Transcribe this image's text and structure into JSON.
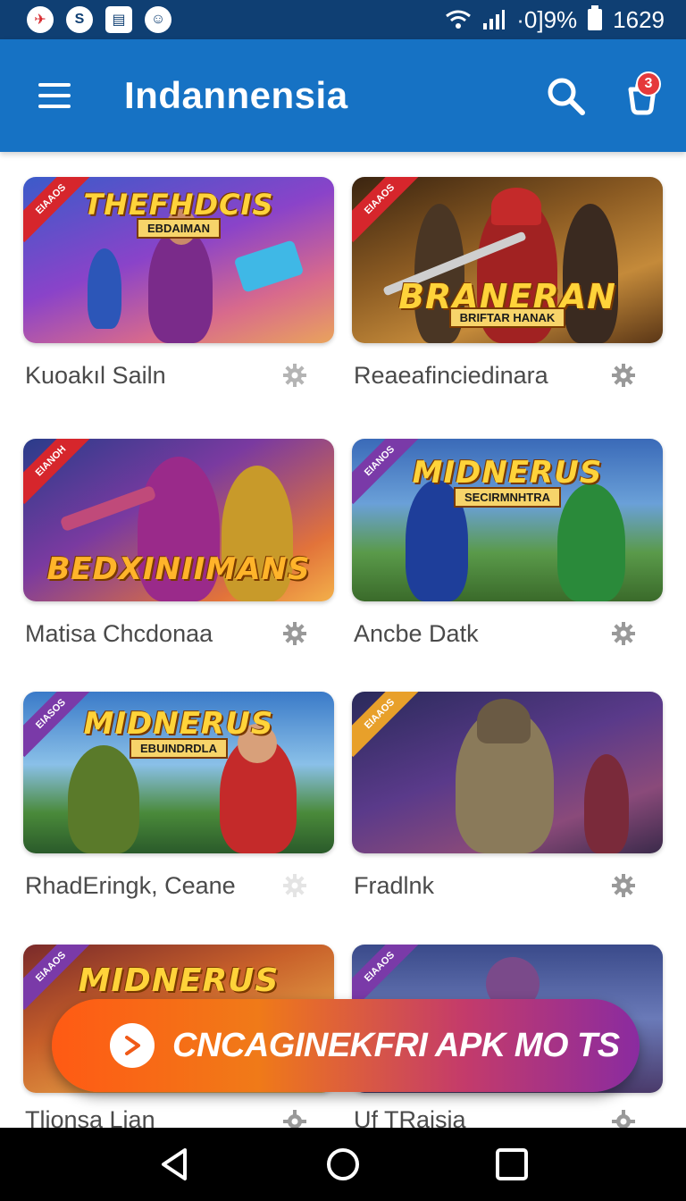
{
  "status_bar": {
    "battery_text": "·0]9%",
    "time": "1629",
    "icons": [
      "app-notification-icon",
      "shazam-icon",
      "message-icon",
      "android-icon",
      "wifi-icon",
      "signal-icon",
      "battery-icon"
    ]
  },
  "app_bar": {
    "title": "Indannensia",
    "cart_badge": "3",
    "colors": {
      "status": "#0f3f73",
      "bar": "#1672c4",
      "badge": "#e5393b"
    }
  },
  "cards": [
    {
      "title": "Kuoakıl Sailn",
      "art_logo": "THEFHDCIS",
      "art_sub": "EBDAIMAN",
      "ribbon": "EIAAOS"
    },
    {
      "title": "Reaeafinciedinara",
      "art_logo": "BRANERAN",
      "art_sub": "BRIFTAR HANAK",
      "ribbon": "EIAAOS"
    },
    {
      "title": "Matisa Chcdonaa",
      "art_logo": "BEDXINIIMANS",
      "art_sub": "",
      "ribbon": "EIANOH"
    },
    {
      "title": "Ancbe Datk",
      "art_logo": "MIDNERUS",
      "art_sub": "SECIRMNHTRA",
      "ribbon": "EIANOS"
    },
    {
      "title": "RhadEringk, Ceane",
      "art_logo": "MIDNERUS",
      "art_sub": "EBUINDRDLA",
      "ribbon": "EIASOS"
    },
    {
      "title": "Fradlnk",
      "art_logo": "",
      "art_sub": "",
      "ribbon": "EIAAOS"
    },
    {
      "title": "Tlionsa Lian",
      "art_logo": "MIDNERUS",
      "art_sub": "",
      "ribbon": "EIAAOS"
    },
    {
      "title": "Uf TRaisia",
      "art_logo": "",
      "art_sub": "",
      "ribbon": "EIAAOS"
    }
  ],
  "cta": {
    "label": "CNCAGINEKFRI APK MO TS"
  },
  "nav": {
    "icons": [
      "back-icon",
      "home-icon",
      "recents-icon"
    ]
  }
}
